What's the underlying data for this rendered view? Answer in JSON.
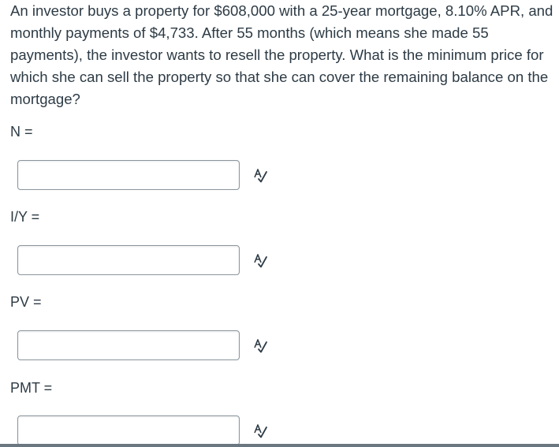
{
  "question": {
    "text": "An investor buys a property for $608,000 with a 25-year mortgage, 8.10% APR, and monthly payments of $4,733. After 55 months (which means she made 55 payments), the investor wants to resell the property. What is the minimum price for which she can sell the property so that she can cover the remaining balance on the mortgage?"
  },
  "fields": [
    {
      "label": "N =",
      "value": ""
    },
    {
      "label": "I/Y =",
      "value": ""
    },
    {
      "label": "PV =",
      "value": ""
    },
    {
      "label": "PMT =",
      "value": ""
    }
  ],
  "icons": {
    "spellcheck": "spellcheck-icon"
  }
}
